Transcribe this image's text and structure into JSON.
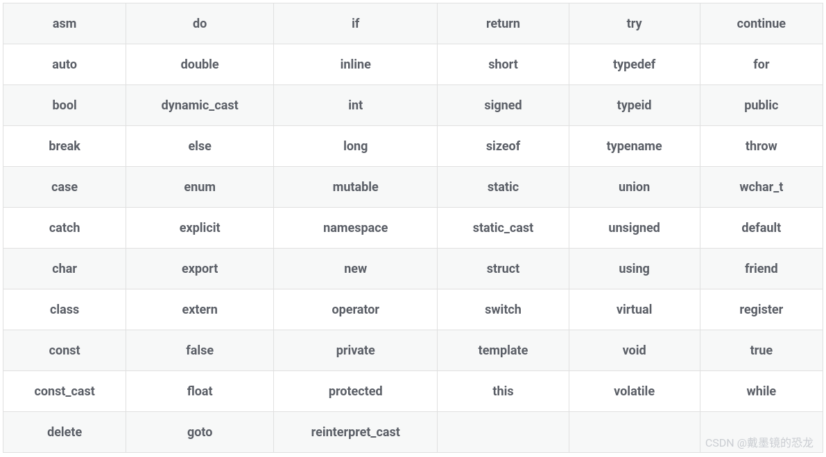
{
  "table": {
    "rows": [
      [
        "asm",
        "do",
        "if",
        "return",
        "try",
        "continue"
      ],
      [
        "auto",
        "double",
        "inline",
        "short",
        "typedef",
        "for"
      ],
      [
        "bool",
        "dynamic_cast",
        "int",
        "signed",
        "typeid",
        "public"
      ],
      [
        "break",
        "else",
        "long",
        "sizeof",
        "typename",
        "throw"
      ],
      [
        "case",
        "enum",
        "mutable",
        "static",
        "union",
        "wchar_t"
      ],
      [
        "catch",
        "explicit",
        "namespace",
        "static_cast",
        "unsigned",
        "default"
      ],
      [
        "char",
        "export",
        "new",
        "struct",
        "using",
        "friend"
      ],
      [
        "class",
        "extern",
        "operator",
        "switch",
        "virtual",
        "register"
      ],
      [
        "const",
        "false",
        "private",
        "template",
        "void",
        "true"
      ],
      [
        "const_cast",
        "float",
        "protected",
        "this",
        "volatile",
        "while"
      ],
      [
        "delete",
        "goto",
        "reinterpret_cast",
        "",
        "",
        ""
      ]
    ]
  },
  "watermark": "CSDN @戴墨镜的恐龙"
}
